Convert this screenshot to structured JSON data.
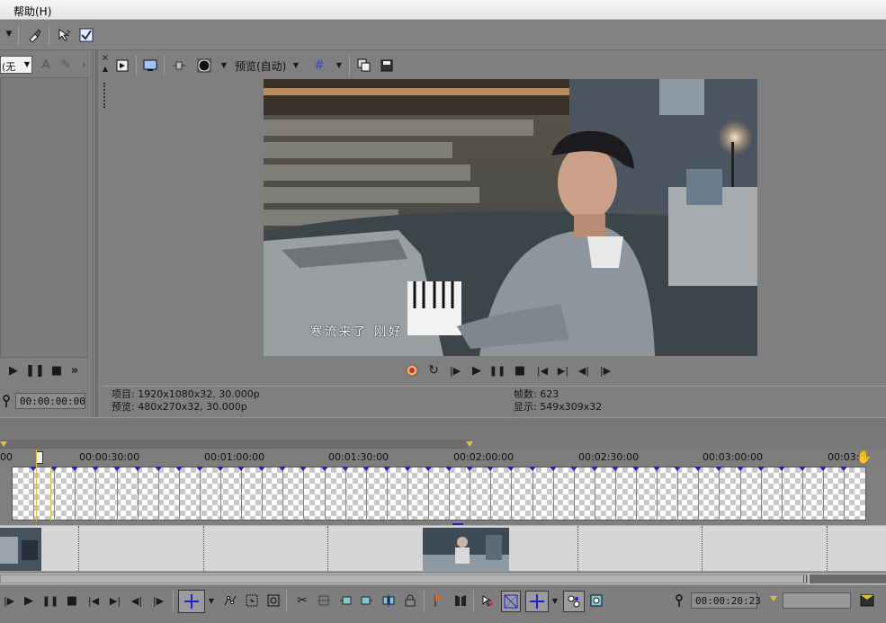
{
  "menu": {
    "help": "帮助(H)"
  },
  "left_panel": {
    "dropdown_value": "(无",
    "timecode": "00:00:00:00"
  },
  "preview_toolbar": {
    "quality_label": "预览(自动)"
  },
  "video": {
    "subtitle": "寒流来了 刚好"
  },
  "info": {
    "project": "项目: 1920x1080x32, 30.000p",
    "preview": "预览: 480x270x32, 30.000p",
    "frames": "帧数: 623",
    "display": "显示: 549x309x32"
  },
  "ruler": {
    "labels": [
      "00:00:30:00",
      "00:01:00:00",
      "00:01:30:00",
      "00:02:00:00",
      "00:02:30:00",
      "00:03:00:00",
      "00:03:"
    ],
    "start_label": "00"
  },
  "bottom": {
    "timecode": "00:00:20:23"
  },
  "colors": {
    "accent_blue": "#1a22c8",
    "marker_yellow": "#d8c23a"
  }
}
